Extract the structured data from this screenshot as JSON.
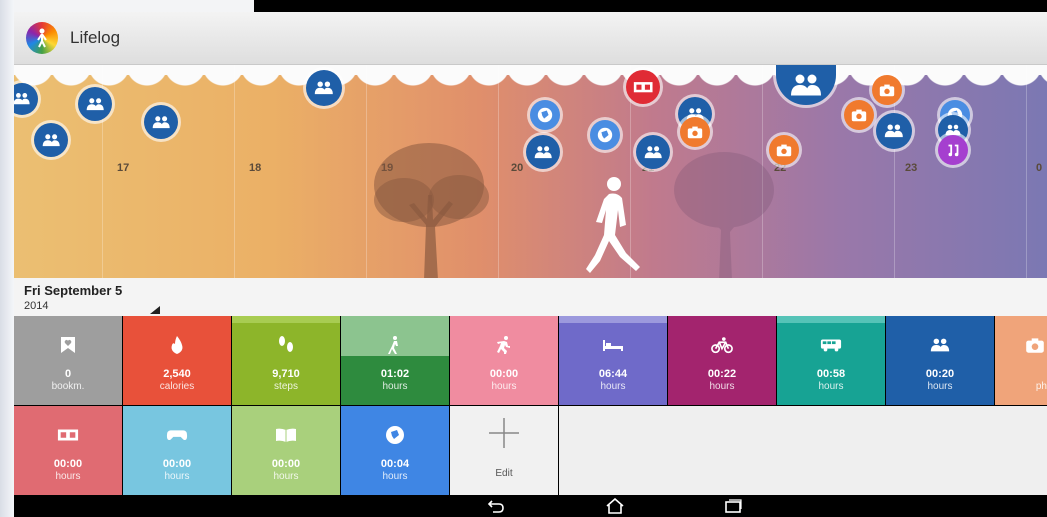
{
  "app": {
    "title": "Lifelog",
    "logo_icon": "lifelog-logo-icon"
  },
  "timeline": {
    "hours": [
      "17",
      "18",
      "19",
      "20",
      "21",
      "22",
      "23",
      "0"
    ],
    "colors": {
      "left": "#ebbf72",
      "right": "#7b78b3"
    }
  },
  "date": {
    "day": "Fri September 5",
    "year": "2014"
  },
  "tiles_row1": [
    {
      "name": "bookmarks",
      "value": "0",
      "unit": "bookm.",
      "icon": "bookmark-icon",
      "color": "#9e9e9e"
    },
    {
      "name": "calories",
      "value": "2,540",
      "unit": "calories",
      "icon": "flame-icon",
      "color": "#e8513a"
    },
    {
      "name": "steps",
      "value": "9,710",
      "unit": "steps",
      "icon": "footsteps-icon",
      "color": "#8db52a"
    },
    {
      "name": "walking",
      "value": "01:02",
      "unit": "hours",
      "icon": "walking-icon",
      "color": "#2e8b3e"
    },
    {
      "name": "running",
      "value": "00:00",
      "unit": "hours",
      "icon": "running-icon",
      "color": "#f08ca0"
    },
    {
      "name": "sleep",
      "value": "06:44",
      "unit": "hours",
      "icon": "bed-icon",
      "color": "#6f6ac9"
    },
    {
      "name": "cycling",
      "value": "00:22",
      "unit": "hours",
      "icon": "bicycle-icon",
      "color": "#a3246e"
    },
    {
      "name": "transport",
      "value": "00:58",
      "unit": "hours",
      "icon": "bus-icon",
      "color": "#17a394"
    },
    {
      "name": "social",
      "value": "00:20",
      "unit": "hours",
      "icon": "people-icon",
      "color": "#1f5fa8"
    },
    {
      "name": "photos",
      "value": "",
      "unit": "ph",
      "icon": "camera-icon",
      "color": "#f0a47a"
    }
  ],
  "tiles_row2": [
    {
      "name": "movies",
      "value": "00:00",
      "unit": "hours",
      "icon": "film-icon",
      "color": "#e06b72"
    },
    {
      "name": "games",
      "value": "00:00",
      "unit": "hours",
      "icon": "gamepad-icon",
      "color": "#78c6e0"
    },
    {
      "name": "reading",
      "value": "00:00",
      "unit": "hours",
      "icon": "book-icon",
      "color": "#a9d07c"
    },
    {
      "name": "browsing",
      "value": "00:04",
      "unit": "hours",
      "icon": "globe-icon",
      "color": "#3f86e4"
    }
  ],
  "edit_tile": {
    "label": "Edit",
    "icon": "plus-icon"
  },
  "nav": {
    "back": "back-icon",
    "home": "home-icon",
    "recents": "recents-icon"
  }
}
